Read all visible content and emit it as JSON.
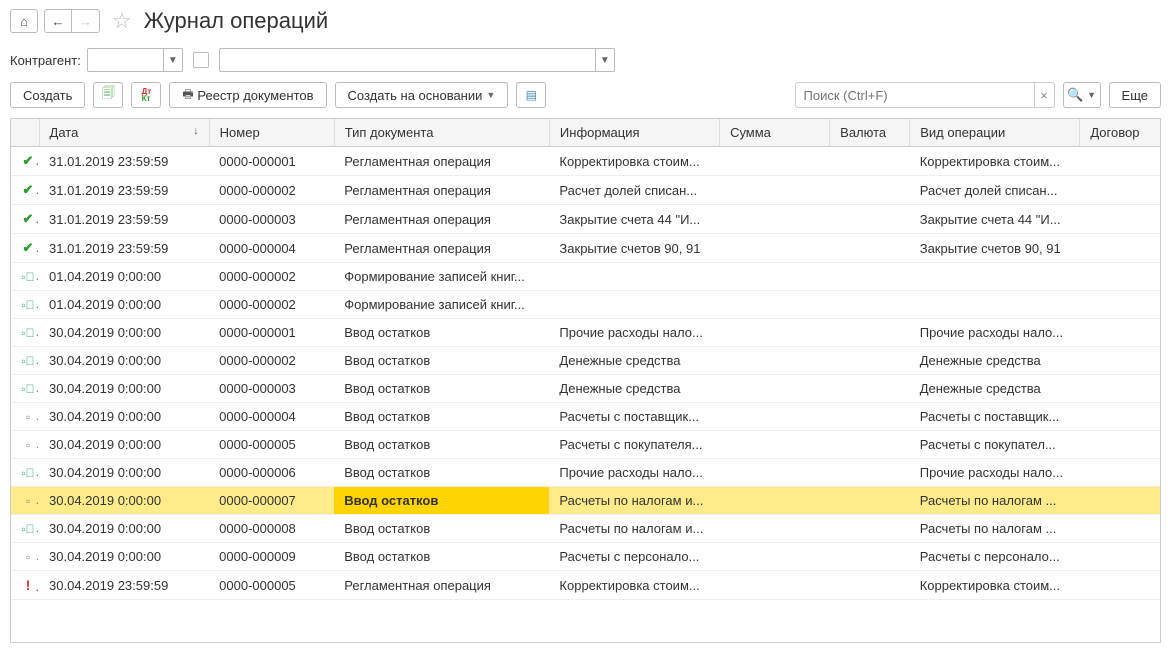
{
  "header": {
    "title": "Журнал операций"
  },
  "filter": {
    "label": "Контрагент:"
  },
  "toolbar": {
    "create": "Создать",
    "registry": "Реестр документов",
    "create_based": "Создать на основании",
    "search_placeholder": "Поиск (Ctrl+F)",
    "more": "Еще"
  },
  "columns": {
    "date": "Дата",
    "number": "Номер",
    "doc_type": "Тип документа",
    "info": "Информация",
    "sum": "Сумма",
    "currency": "Валюта",
    "op_type": "Вид операции",
    "contract": "Договор"
  },
  "rows": [
    {
      "icon": "check",
      "date": "31.01.2019 23:59:59",
      "num": "0000-000001",
      "type": "Регламентная операция",
      "info": "Корректировка стоим...",
      "sum": "",
      "cur": "",
      "op": "Корректировка стоим...",
      "cont": ""
    },
    {
      "icon": "check",
      "date": "31.01.2019 23:59:59",
      "num": "0000-000002",
      "type": "Регламентная операция",
      "info": "Расчет долей списан...",
      "sum": "",
      "cur": "",
      "op": "Расчет долей списан...",
      "cont": ""
    },
    {
      "icon": "check",
      "date": "31.01.2019 23:59:59",
      "num": "0000-000003",
      "type": "Регламентная операция",
      "info": "Закрытие счета 44 \"И...",
      "sum": "",
      "cur": "",
      "op": "Закрытие счета 44 \"И...",
      "cont": ""
    },
    {
      "icon": "check",
      "date": "31.01.2019 23:59:59",
      "num": "0000-000004",
      "type": "Регламентная операция",
      "info": "Закрытие счетов 90, 91",
      "sum": "",
      "cur": "",
      "op": "Закрытие счетов 90, 91",
      "cont": ""
    },
    {
      "icon": "doc-ok",
      "date": "01.04.2019 0:00:00",
      "num": "0000-000002",
      "type": "Формирование записей книг...",
      "info": "",
      "sum": "",
      "cur": "",
      "op": "",
      "cont": ""
    },
    {
      "icon": "doc-ok",
      "date": "01.04.2019 0:00:00",
      "num": "0000-000002",
      "type": "Формирование записей книг...",
      "info": "",
      "sum": "",
      "cur": "",
      "op": "",
      "cont": ""
    },
    {
      "icon": "doc-ok",
      "date": "30.04.2019 0:00:00",
      "num": "0000-000001",
      "type": "Ввод остатков",
      "info": "Прочие расходы нало...",
      "sum": "",
      "cur": "",
      "op": "Прочие расходы нало...",
      "cont": ""
    },
    {
      "icon": "doc-ok",
      "date": "30.04.2019 0:00:00",
      "num": "0000-000002",
      "type": "Ввод остатков",
      "info": "Денежные средства",
      "sum": "",
      "cur": "",
      "op": "Денежные средства",
      "cont": ""
    },
    {
      "icon": "doc-ok",
      "date": "30.04.2019 0:00:00",
      "num": "0000-000003",
      "type": "Ввод остатков",
      "info": "Денежные средства",
      "sum": "",
      "cur": "",
      "op": "Денежные средства",
      "cont": ""
    },
    {
      "icon": "doc",
      "date": "30.04.2019 0:00:00",
      "num": "0000-000004",
      "type": "Ввод остатков",
      "info": "Расчеты с поставщик...",
      "sum": "",
      "cur": "",
      "op": "Расчеты с поставщик...",
      "cont": ""
    },
    {
      "icon": "doc",
      "date": "30.04.2019 0:00:00",
      "num": "0000-000005",
      "type": "Ввод остатков",
      "info": "Расчеты с покупателя...",
      "sum": "",
      "cur": "",
      "op": "Расчеты с покупател...",
      "cont": ""
    },
    {
      "icon": "doc-ok",
      "date": "30.04.2019 0:00:00",
      "num": "0000-000006",
      "type": "Ввод остатков",
      "info": "Прочие расходы нало...",
      "sum": "",
      "cur": "",
      "op": "Прочие расходы нало...",
      "cont": ""
    },
    {
      "icon": "doc",
      "date": "30.04.2019 0:00:00",
      "num": "0000-000007",
      "type": "Ввод остатков",
      "info": "Расчеты по налогам и...",
      "sum": "",
      "cur": "",
      "op": "Расчеты по налогам ...",
      "cont": "",
      "selected": true
    },
    {
      "icon": "doc-ok",
      "date": "30.04.2019 0:00:00",
      "num": "0000-000008",
      "type": "Ввод остатков",
      "info": "Расчеты по налогам и...",
      "sum": "",
      "cur": "",
      "op": "Расчеты по налогам ...",
      "cont": ""
    },
    {
      "icon": "doc",
      "date": "30.04.2019 0:00:00",
      "num": "0000-000009",
      "type": "Ввод остатков",
      "info": "Расчеты с персонало...",
      "sum": "",
      "cur": "",
      "op": "Расчеты с персонало...",
      "cont": ""
    },
    {
      "icon": "warn",
      "date": "30.04.2019 23:59:59",
      "num": "0000-000005",
      "type": "Регламентная операция",
      "info": "Корректировка стоим...",
      "sum": "",
      "cur": "",
      "op": "Корректировка стоим...",
      "cont": ""
    }
  ]
}
